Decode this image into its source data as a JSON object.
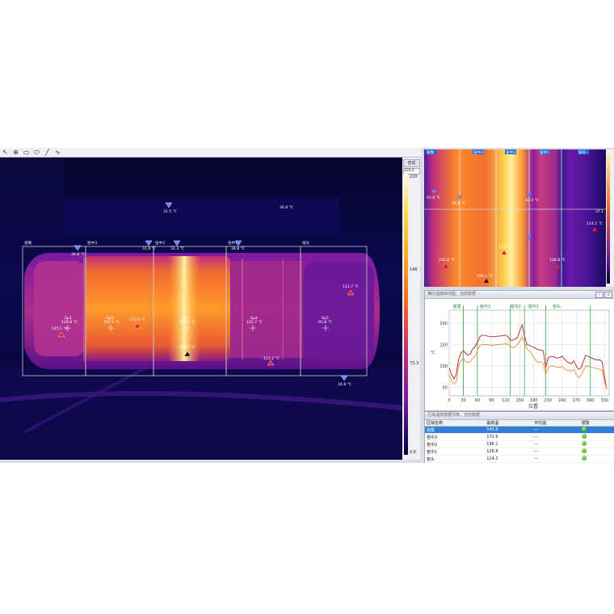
{
  "toolbar": {
    "icons": [
      "arrow-icon",
      "crosshair-icon",
      "rectangle-tool-icon",
      "ellipse-tool-icon",
      "line-tool-icon",
      "polyline-tool-icon"
    ],
    "glyphs": [
      "↖",
      "⊕",
      "▭",
      "⬭",
      "╱",
      "∿"
    ]
  },
  "scale": {
    "button": "自动",
    "max_value": "220.0",
    "top_label": "220",
    "mid_label": "146",
    "low_label": "73.3",
    "bottom_label": "0.6"
  },
  "thermal": {
    "regions": [
      {
        "name": "窑尾"
      },
      {
        "name": "窑中3"
      },
      {
        "name": "窑中2"
      },
      {
        "name": "窑中1"
      },
      {
        "name": "窑头"
      }
    ],
    "cold_markers": [
      {
        "label": "31.5 ℃"
      },
      {
        "label": "36.8 ℃"
      },
      {
        "label": "31.8 ℃"
      },
      {
        "label": "31.3 ℃"
      },
      {
        "label": "34.8 ℃"
      },
      {
        "label": "34.8 ℃"
      }
    ],
    "hot_markers": [
      {
        "label": "145.1 ℃"
      },
      {
        "label": "172.6 ℃"
      },
      {
        "label": "196.1 ℃"
      },
      {
        "label": "123.2 ℃"
      },
      {
        "label": "111.7 ℃"
      }
    ],
    "spots": [
      {
        "name": "Sp1",
        "value": "128.8 ℃"
      },
      {
        "name": "Sp2",
        "value": "150.5 ℃"
      },
      {
        "name": "Sp3",
        "value": "188.4 ℃"
      },
      {
        "name": "Sp4",
        "value": "102.7 ℃"
      },
      {
        "name": "Sp5",
        "value": "93.8 ℃"
      }
    ],
    "floating_label": "36.8 ℃"
  },
  "strip": {
    "tags": [
      "窑尾",
      "窑中3",
      "窑中2",
      "窑中1",
      "窑头"
    ],
    "labels": [
      "41.8 ℃",
      "36.8 ℃",
      "42.4 ℃",
      "37.1",
      "114.2 ℃",
      "145.8 ℃",
      "172.6 ℃",
      "196.1 ℃",
      "128.8 ℃"
    ]
  },
  "chart_panel": {
    "title": "横向温度曲线图，当前数据 ...",
    "xlabel": "位置",
    "ylabel": "℃",
    "region_tags": [
      "窑尾",
      "窑中3",
      "窑中2",
      "窑中1",
      "窑头"
    ],
    "yticks": [
      "200",
      "150",
      "100",
      "50"
    ],
    "xticks": [
      "0",
      "30",
      "60",
      "90",
      "120",
      "150",
      "180",
      "210",
      "240",
      "270",
      "300",
      "330"
    ]
  },
  "table_panel": {
    "title": "区域温度数据列表，当前数据 ...",
    "headers": [
      "区域名称",
      "最高温",
      "平均温",
      "报警"
    ],
    "rows": [
      {
        "name": "窑尾",
        "max": "145.8",
        "avg": "---"
      },
      {
        "name": "窑中3",
        "max": "172.6",
        "avg": "---"
      },
      {
        "name": "窑中2",
        "max": "196.1",
        "avg": "---"
      },
      {
        "name": "窑中1",
        "max": "128.8",
        "avg": "---"
      },
      {
        "name": "窑头",
        "max": "114.2",
        "avg": "---"
      }
    ]
  },
  "colors": {
    "series_max": "#b8202a",
    "series_avg": "#e89030",
    "region_line": "#3aa84a",
    "cursor_line": "#e0e8ff",
    "selected_row": "#2f7fd8"
  },
  "chart_data": {
    "type": "line",
    "xlabel": "位置",
    "ylabel": "℃",
    "xlim": [
      0,
      340
    ],
    "ylim": [
      30,
      230
    ],
    "series": [
      {
        "x": [
          0,
          5,
          10,
          15,
          20,
          25,
          30,
          35,
          40,
          45,
          50,
          55,
          60,
          65,
          70,
          80,
          90,
          100,
          110,
          120,
          125,
          130,
          135,
          140,
          145,
          150,
          155,
          160,
          165,
          170,
          175,
          180,
          185,
          190,
          195,
          200,
          205,
          210,
          215,
          220,
          230,
          240,
          250,
          260,
          265,
          270,
          275,
          280,
          290,
          300,
          310,
          320,
          325,
          330,
          335
        ],
        "y": [
          95,
          80,
          70,
          80,
          115,
          130,
          135,
          130,
          125,
          128,
          140,
          145,
          155,
          168,
          172,
          170,
          168,
          169,
          170,
          172,
          168,
          160,
          160,
          163,
          166,
          182,
          196,
          170,
          150,
          148,
          146,
          143,
          140,
          138,
          137,
          135,
          95,
          118,
          122,
          122,
          118,
          122,
          110,
          105,
          112,
          100,
          92,
          95,
          125,
          120,
          115,
          114,
          110,
          75,
          45
        ]
      },
      {
        "x": [
          0,
          5,
          10,
          15,
          20,
          25,
          30,
          35,
          40,
          45,
          50,
          55,
          60,
          65,
          70,
          80,
          90,
          100,
          110,
          120,
          125,
          130,
          135,
          140,
          145,
          150,
          155,
          160,
          165,
          170,
          175,
          180,
          185,
          190,
          195,
          200,
          205,
          210,
          215,
          220,
          230,
          240,
          250,
          260,
          265,
          270,
          275,
          280,
          290,
          300,
          310,
          320,
          325,
          330,
          335
        ],
        "y": [
          80,
          65,
          58,
          62,
          100,
          112,
          118,
          110,
          108,
          110,
          118,
          122,
          135,
          148,
          150,
          150,
          148,
          150,
          150,
          152,
          150,
          145,
          142,
          145,
          150,
          158,
          168,
          155,
          140,
          135,
          128,
          120,
          112,
          108,
          110,
          105,
          80,
          95,
          100,
          100,
          96,
          98,
          90,
          88,
          92,
          80,
          72,
          78,
          100,
          98,
          95,
          92,
          90,
          65,
          45
        ]
      }
    ],
    "grid": true
  }
}
